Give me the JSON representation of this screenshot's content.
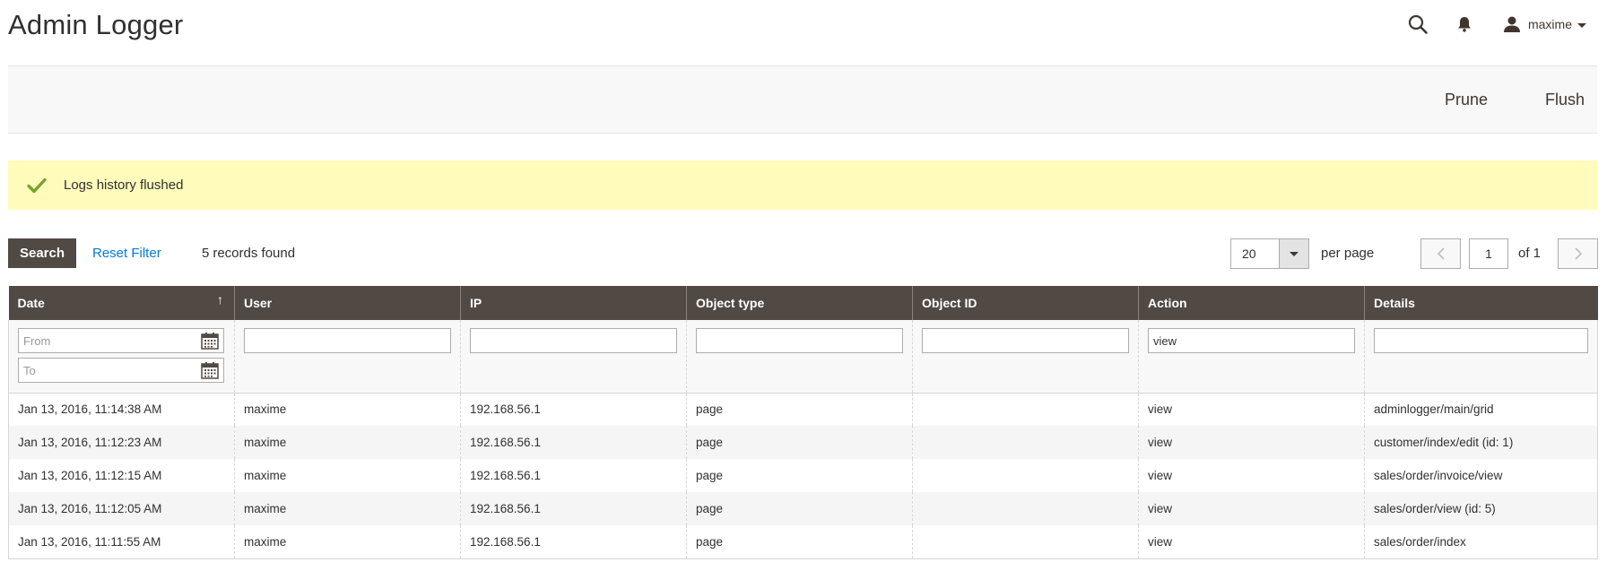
{
  "header": {
    "title": "Admin Logger",
    "user_name": "maxime"
  },
  "actions": {
    "prune_label": "Prune",
    "flush_label": "Flush"
  },
  "message": {
    "text": "Logs history flushed"
  },
  "toolbar": {
    "search_label": "Search",
    "reset_label": "Reset Filter",
    "records_count": "5",
    "records_label": "records found",
    "limit_value": "20",
    "per_page_label": "per page",
    "current_page": "1",
    "page_of": "of 1"
  },
  "grid": {
    "columns": [
      "Date",
      "User",
      "IP",
      "Object type",
      "Object ID",
      "Action",
      "Details"
    ],
    "sort_indicator": "↑",
    "filters": {
      "date_from_placeholder": "From",
      "date_to_placeholder": "To",
      "user": "",
      "ip": "",
      "object_type": "",
      "object_id": "",
      "action": "view",
      "details": ""
    },
    "rows": [
      [
        "Jan 13, 2016, 11:14:38 AM",
        "maxime",
        "192.168.56.1",
        "page",
        "",
        "view",
        "adminlogger/main/grid"
      ],
      [
        "Jan 13, 2016, 11:12:23 AM",
        "maxime",
        "192.168.56.1",
        "page",
        "",
        "view",
        "customer/index/edit (id: 1)"
      ],
      [
        "Jan 13, 2016, 11:12:15 AM",
        "maxime",
        "192.168.56.1",
        "page",
        "",
        "view",
        "sales/order/invoice/view"
      ],
      [
        "Jan 13, 2016, 11:12:05 AM",
        "maxime",
        "192.168.56.1",
        "page",
        "",
        "view",
        "sales/order/view (id: 5)"
      ],
      [
        "Jan 13, 2016, 11:11:55 AM",
        "maxime",
        "192.168.56.1",
        "page",
        "",
        "view",
        "sales/order/index"
      ]
    ]
  },
  "colors": {
    "header_bg": "#514943",
    "message_bg": "#fffbbb",
    "success_check": "#79a22e",
    "link": "#007bdb"
  },
  "icons": {
    "search": "search-icon",
    "notifications": "bell-icon",
    "user": "user-icon",
    "success": "check-icon",
    "calendar": "calendar-icon"
  }
}
